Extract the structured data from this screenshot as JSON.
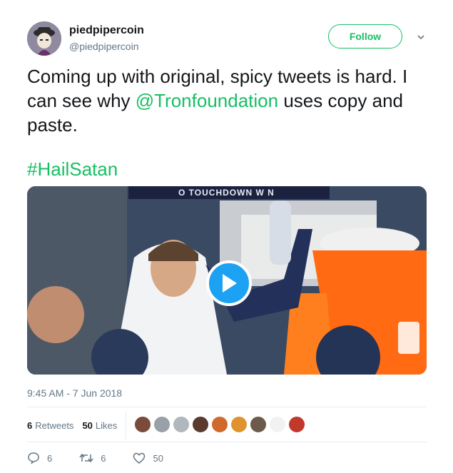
{
  "author": {
    "display_name": "piedpipercoin",
    "handle": "@piedpipercoin"
  },
  "follow_label": "Follow",
  "tweet": {
    "text_before": "Coming up with original, spicy tweets is hard. I can see why ",
    "mention": "@Tronfoundation",
    "text_after": " uses copy and paste.",
    "hashtag": "#HailSatan"
  },
  "media": {
    "type": "video",
    "scoreboard_text": "O TOUCHDOWN W N"
  },
  "timestamp": "9:45 AM - 7 Jun 2018",
  "stats": {
    "retweets_count": "6",
    "retweets_label": "Retweets",
    "likes_count": "50",
    "likes_label": "Likes"
  },
  "liker_avatars": [
    {
      "color": "#7a4b3a"
    },
    {
      "color": "#9aa0a8"
    },
    {
      "color": "#b0b7bd"
    },
    {
      "color": "#5a3b2e"
    },
    {
      "color": "#d06a2c"
    },
    {
      "color": "#e0922f"
    },
    {
      "color": "#6c5a4a"
    },
    {
      "color": "#f2f2f2"
    },
    {
      "color": "#c0392b"
    }
  ],
  "actions": {
    "reply_count": "6",
    "retweet_count": "6",
    "like_count": "50"
  },
  "colors": {
    "accent_green": "#17bf63",
    "play_blue": "#1da1f2",
    "secondary_text": "#657786"
  }
}
